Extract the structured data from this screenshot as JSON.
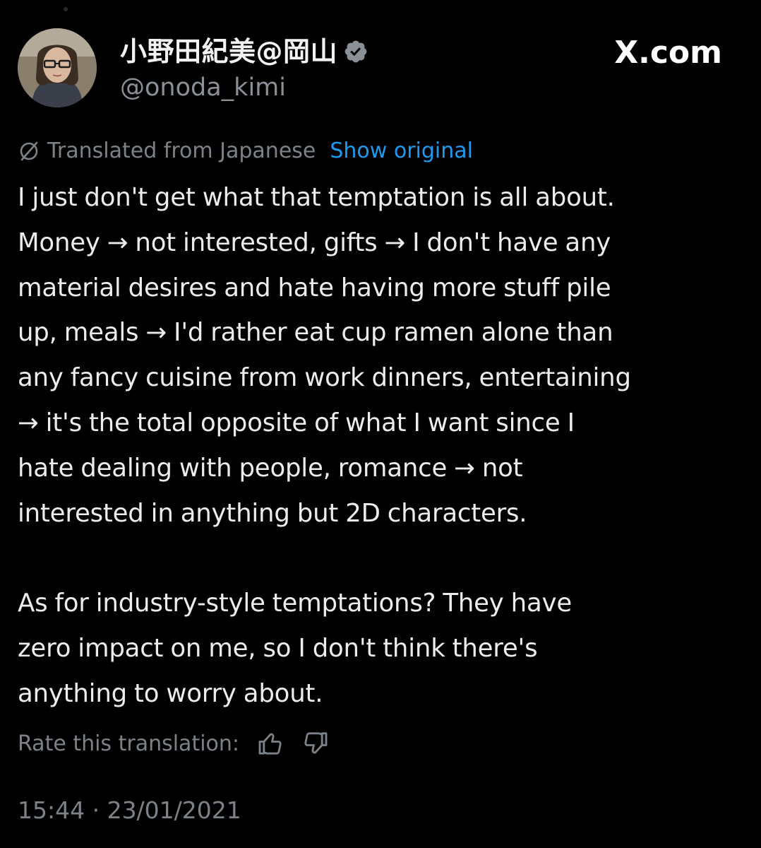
{
  "author": {
    "display_name": "小野田紀美@岡山",
    "handle": "@onoda_kimi",
    "verified": true,
    "avatar_icon": "avatar-photo"
  },
  "brand": {
    "site": "X.com"
  },
  "translation": {
    "label": "Translated from Japanese",
    "show_original_label": "Show original",
    "icon": "globe-slash-icon"
  },
  "tweet": {
    "paragraph1": [
      "I just don't get what that temptation is all about.",
      "Money → not interested, gifts → I don't have any",
      "material desires and hate having more stuff pile",
      "up, meals → I'd rather eat cup ramen alone than",
      "any fancy cuisine from work dinners, entertaining",
      "→ it's the total opposite of what I want since I",
      "hate dealing with people, romance → not",
      "interested in anything but 2D characters."
    ],
    "paragraph2": [
      "As for industry-style temptations? They have",
      "zero impact on me, so I don't think there's",
      "anything to worry about."
    ]
  },
  "rating": {
    "label": "Rate this translation:",
    "thumbs_up_icon": "thumbs-up-icon",
    "thumbs_down_icon": "thumbs-down-icon"
  },
  "meta": {
    "timestamp": "15:44 · 23/01/2021"
  },
  "colors": {
    "background": "#000000",
    "text": "#e7e9ea",
    "muted": "#7d8288",
    "link": "#1d9bf0"
  }
}
